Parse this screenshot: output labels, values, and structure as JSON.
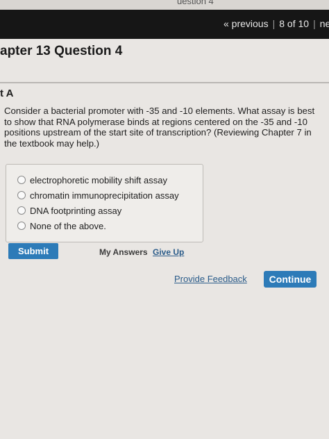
{
  "top_strip_text": "uestion 4",
  "nav": {
    "previous": "« previous",
    "position": "8 of 10",
    "next": "ne"
  },
  "title": "apter 13 Question 4",
  "part_label": "t A",
  "question": {
    "line1": "Consider a bacterial promoter with -35 and -10 elements. What assay is best",
    "line2": "to show that RNA polymerase binds at regions centered on the -35 and -10",
    "line3": "positions upstream of the start site of transcription? (Reviewing Chapter 7 in",
    "line4": "the textbook may help.)"
  },
  "choices": [
    {
      "label": "electrophoretic mobility shift assay"
    },
    {
      "label": "chromatin immunoprecipitation assay"
    },
    {
      "label": "DNA footprinting assay"
    },
    {
      "label": "None of the above."
    }
  ],
  "actions": {
    "submit": "Submit",
    "my_answers": "My Answers",
    "give_up": "Give Up",
    "provide_feedback": "Provide Feedback",
    "continue": "Continue"
  },
  "colors": {
    "accent_button": "#2d7bb8",
    "link": "#2b5c8a",
    "top_bar": "#161616"
  }
}
